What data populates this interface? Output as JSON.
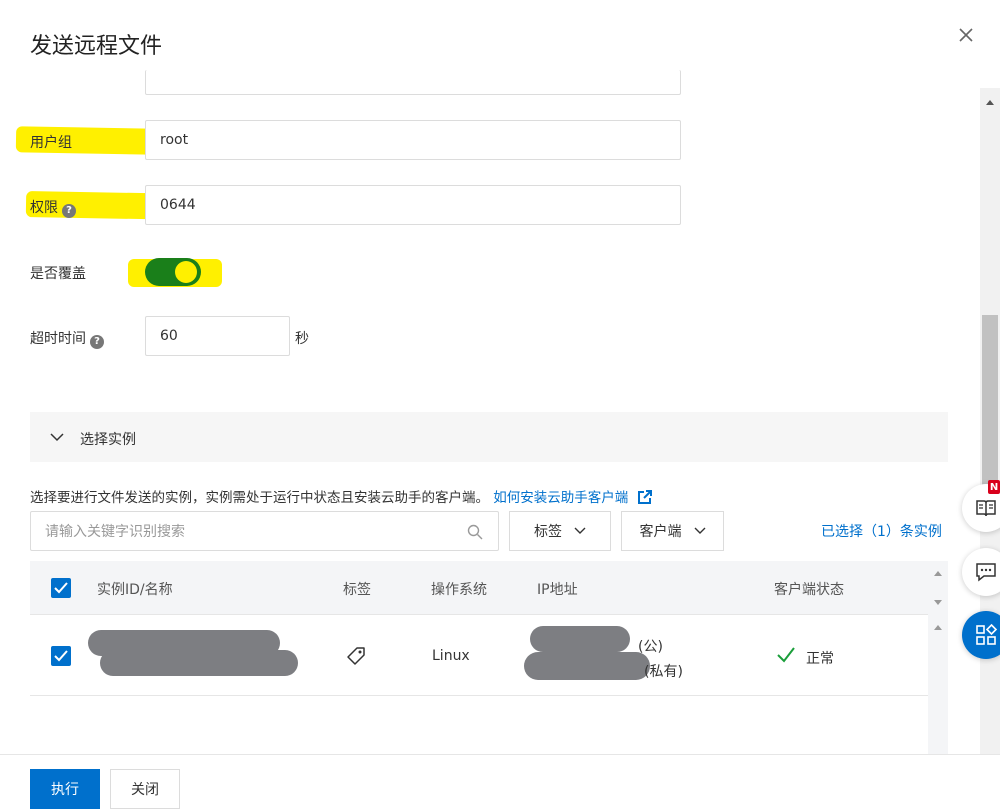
{
  "dialog": {
    "title": "发送远程文件"
  },
  "form": {
    "user_group_label": "用户组",
    "user_group_value": "root",
    "permission_label": "权限",
    "permission_value": "0644",
    "overwrite_label": "是否覆盖",
    "overwrite_on": true,
    "timeout_label": "超时时间",
    "timeout_value": "60",
    "timeout_unit": "秒"
  },
  "instances": {
    "section_title": "选择实例",
    "description": "选择要进行文件发送的实例，实例需处于运行中状态且安装云助手的客户端。",
    "install_link": "如何安装云助手客户端",
    "search_placeholder": "请输入关键字识别搜索",
    "tag_filter": "标签",
    "client_filter": "客户端",
    "selected_text": "已选择（1）条实例",
    "columns": [
      "实例ID/名称",
      "标签",
      "操作系统",
      "IP地址",
      "客户端状态"
    ],
    "rows": [
      {
        "os": "Linux",
        "ip_public_suffix": "(公)",
        "ip_private_suffix": "(私有)",
        "status": "正常"
      }
    ]
  },
  "footer": {
    "execute_label": "执行",
    "close_label": "关闭"
  },
  "side": {
    "badge": "N"
  },
  "colors": {
    "primary": "#0070cc",
    "highlight": "#fff000",
    "toggle_on": "#1a7f1a",
    "success": "#1a9e3a"
  }
}
